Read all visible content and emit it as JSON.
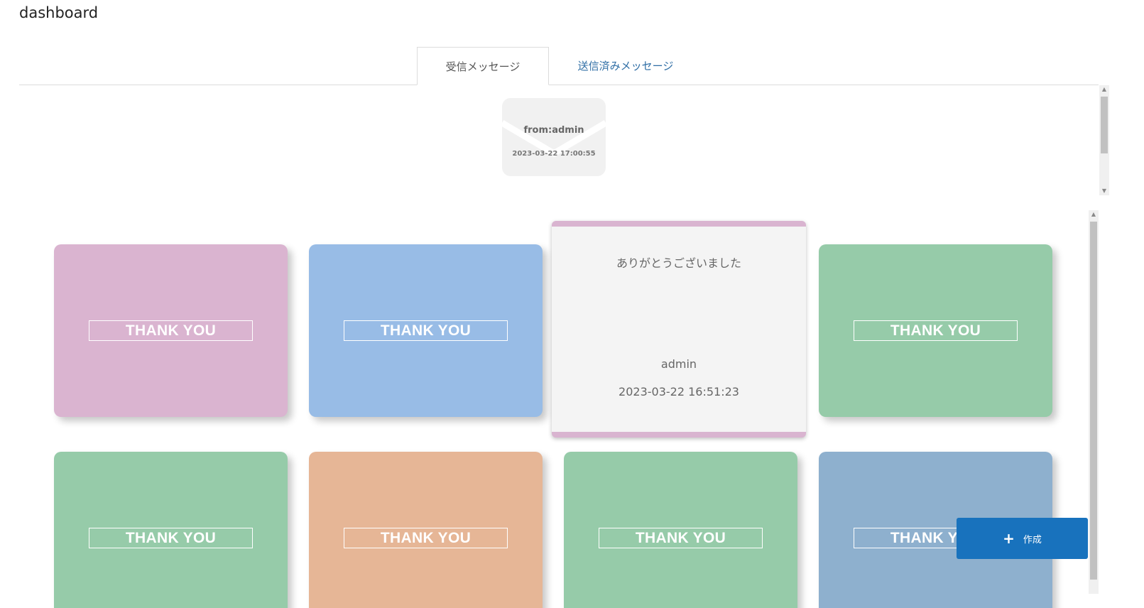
{
  "page": {
    "title": "dashboard"
  },
  "tabs": [
    {
      "label": "受信メッセージ",
      "active": true
    },
    {
      "label": "送信済みメッセージ",
      "active": false
    }
  ],
  "inbox": {
    "envelope": {
      "from": "from:admin",
      "date": "2023-03-22 17:00:55"
    }
  },
  "cards": [
    {
      "label": "THANK YOU",
      "color": "#dab4d0"
    },
    {
      "label": "THANK YOU",
      "color": "#98bce6"
    },
    {
      "label": "THANK YOU",
      "color": "#96cba9"
    },
    {
      "label": "THANK YOU",
      "color": "#96cba9"
    },
    {
      "label": "THANK YOU",
      "color": "#e6b696"
    },
    {
      "label": "THANK YOU",
      "color": "#96cba9"
    },
    {
      "label": "THANK YOU",
      "color": "#8eb0ce"
    }
  ],
  "opened_card": {
    "message": "ありがとうございました",
    "sender": "admin",
    "date": "2023-03-22 16:51:23",
    "accent": "#d9b4d0"
  },
  "create_button": {
    "icon": "plus-icon",
    "label": "作成"
  }
}
